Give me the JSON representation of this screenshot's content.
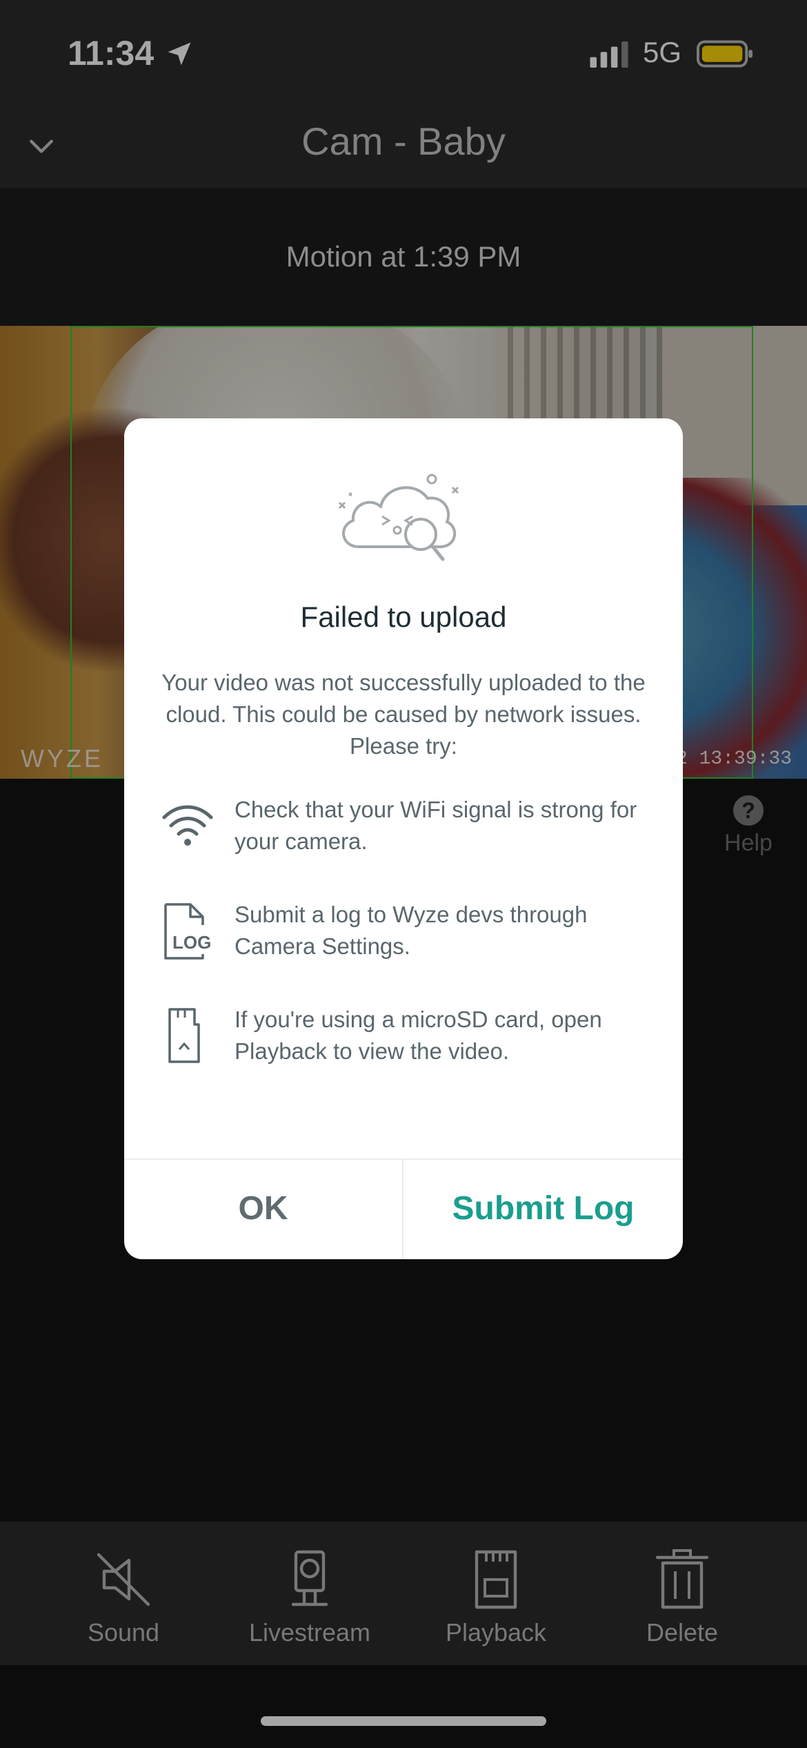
{
  "status_bar": {
    "time": "11:34",
    "network": "5G"
  },
  "header": {
    "title": "Cam - Baby"
  },
  "event": {
    "label": "Motion at 1:39 PM"
  },
  "video": {
    "watermark": "WYZE",
    "timestamp": "2 13:39:33"
  },
  "help": {
    "icon": "?",
    "label": "Help"
  },
  "modal": {
    "title": "Failed to upload",
    "description": "Your video was not successfully uploaded to the cloud. This could be caused by network issues. Please try:",
    "tips": [
      {
        "icon": "wifi-icon",
        "text": "Check that your WiFi signal is strong for your camera."
      },
      {
        "icon": "log-file-icon",
        "text": "Submit a log to Wyze devs through Camera Settings."
      },
      {
        "icon": "microsd-card-icon",
        "text": "If you're using a microSD card, open Playback to view the video."
      }
    ],
    "ok_label": "OK",
    "submit_label": "Submit Log",
    "log_icon_text": "LOG"
  },
  "bottom_bar": {
    "items": [
      {
        "label": "Sound",
        "icon": "sound-muted-icon"
      },
      {
        "label": "Livestream",
        "icon": "camera-icon"
      },
      {
        "label": "Playback",
        "icon": "sd-card-icon"
      },
      {
        "label": "Delete",
        "icon": "trash-icon"
      }
    ]
  },
  "colors": {
    "accent": "#1a9e8e",
    "battery": "#ffd60a",
    "motion_box": "#33c633"
  }
}
